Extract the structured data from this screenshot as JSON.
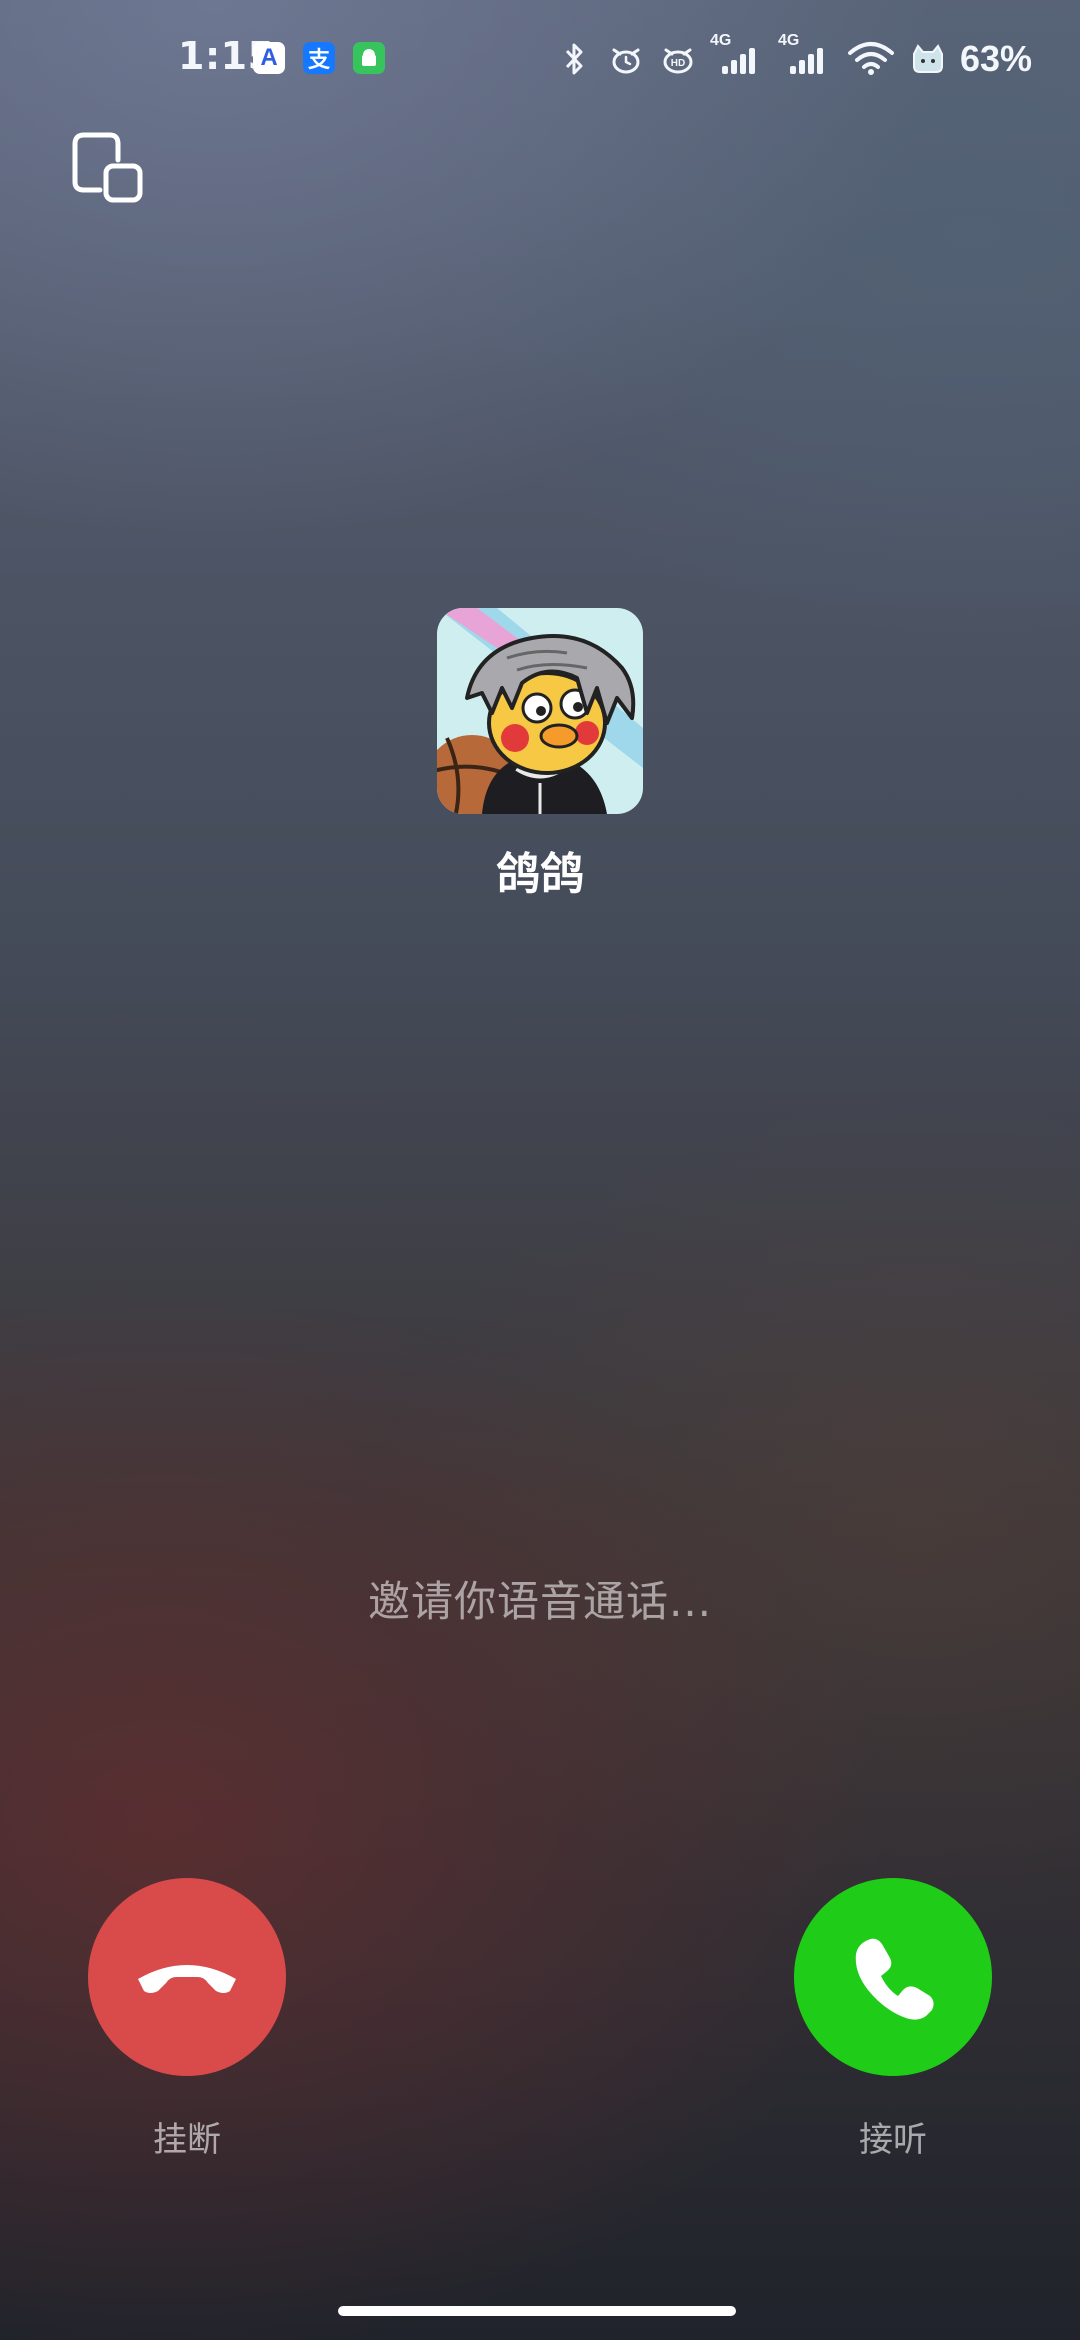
{
  "status_bar": {
    "time": "1:15",
    "battery": "63%",
    "apps": [
      {
        "label": "A",
        "icon": "app-store-icon"
      },
      {
        "label": "支",
        "icon": "alipay-icon"
      },
      {
        "label": "▮",
        "icon": "android-icon"
      }
    ],
    "signal_1_tag": "4G",
    "signal_2_tag": "4G",
    "hd_tag": "HD"
  },
  "caller": {
    "name": "鸽鸽"
  },
  "call": {
    "status_text": "邀请你语音通话...",
    "decline_label": "挂断",
    "accept_label": "接听"
  },
  "colors": {
    "decline": "#d94b4a",
    "accept": "#1fcc17"
  }
}
